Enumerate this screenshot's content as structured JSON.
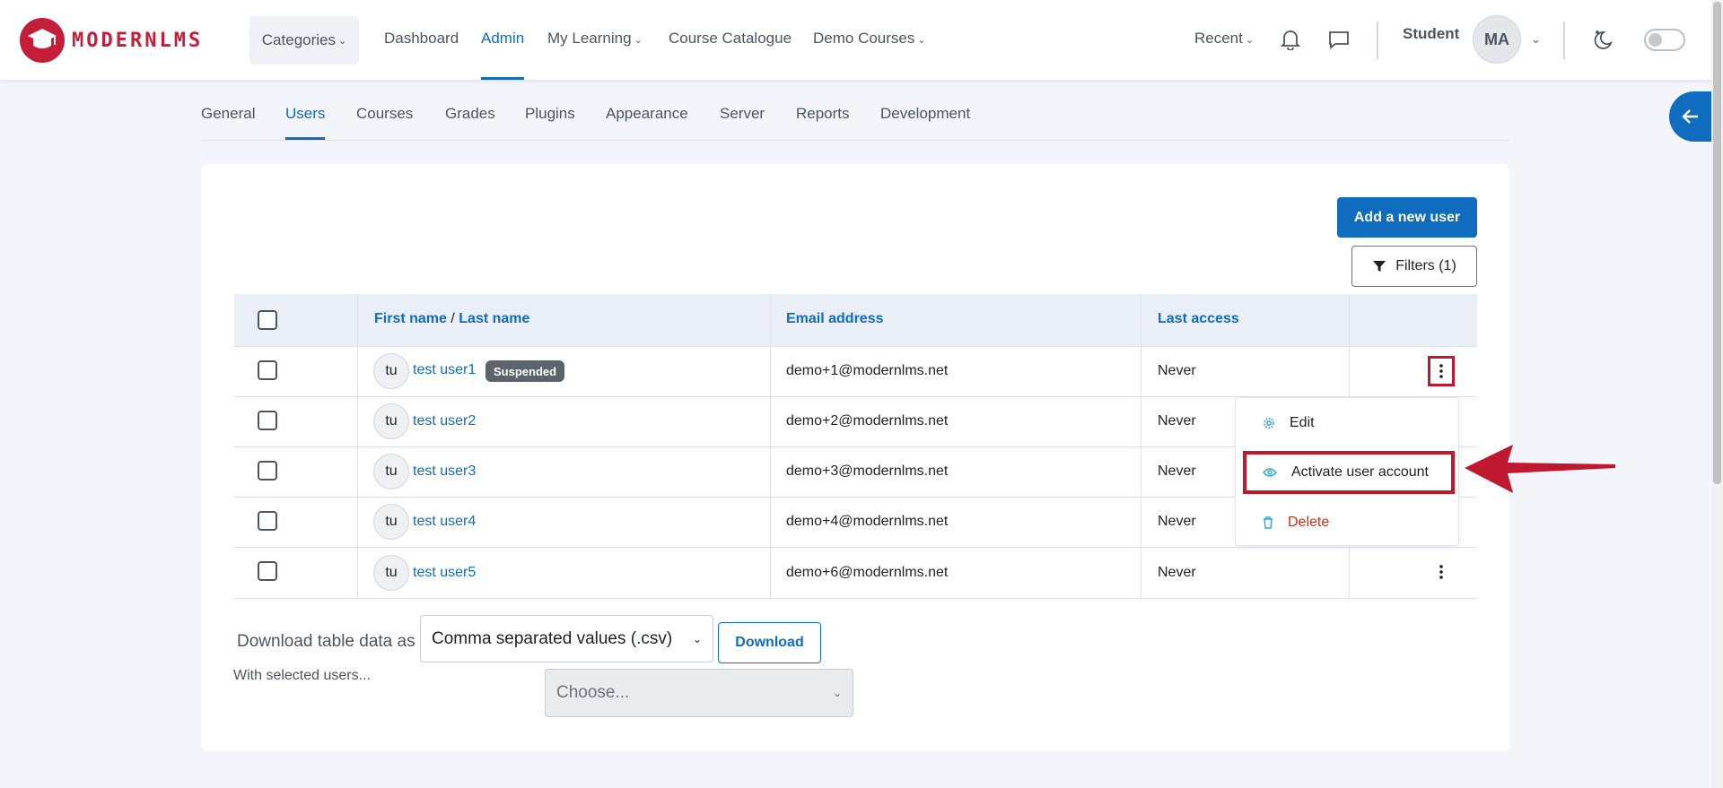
{
  "brand": {
    "name": "MODERNLMS",
    "color": "#c41e3a",
    "tagline": "MODERNLMS"
  },
  "nav": {
    "categories": "Categories",
    "links": [
      "Dashboard",
      "Admin",
      "My Learning",
      "Course Catalogue",
      "Demo Courses"
    ],
    "active": "Admin",
    "recent": "Recent",
    "user_label": "Student",
    "user_initials": "MA"
  },
  "tabs": {
    "items": [
      "General",
      "Users",
      "Courses",
      "Grades",
      "Plugins",
      "Appearance",
      "Server",
      "Reports",
      "Development"
    ],
    "active": "Users"
  },
  "actions": {
    "add_user": "Add a new user",
    "filters": "Filters (1)"
  },
  "table": {
    "headers": {
      "first_name": "First name",
      "sep": " / ",
      "last_name": "Last name",
      "email": "Email address",
      "last_access": "Last access"
    },
    "rows": [
      {
        "initials": "tu",
        "name": "test user1",
        "badge": "Suspended",
        "email": "demo+1@modernlms.net",
        "last_access": "Never"
      },
      {
        "initials": "tu",
        "name": "test user2",
        "email": "demo+2@modernlms.net",
        "last_access": "Never"
      },
      {
        "initials": "tu",
        "name": "test user3",
        "email": "demo+3@modernlms.net",
        "last_access": "Never"
      },
      {
        "initials": "tu",
        "name": "test user4",
        "email": "demo+4@modernlms.net",
        "last_access": "Never"
      },
      {
        "initials": "tu",
        "name": "test user5",
        "email": "demo+6@modernlms.net",
        "last_access": "Never"
      }
    ]
  },
  "menu": {
    "edit": "Edit",
    "activate": "Activate user account",
    "delete": "Delete"
  },
  "footer": {
    "download_label": "Download table data as",
    "format_selected": "Comma separated values (.csv)",
    "download_button": "Download",
    "with_selected": "With selected users...",
    "bulk_placeholder": "Choose..."
  },
  "colors": {
    "primary": "#0f6cbf",
    "highlight": "#c0182f",
    "danger": "#ca3120"
  }
}
